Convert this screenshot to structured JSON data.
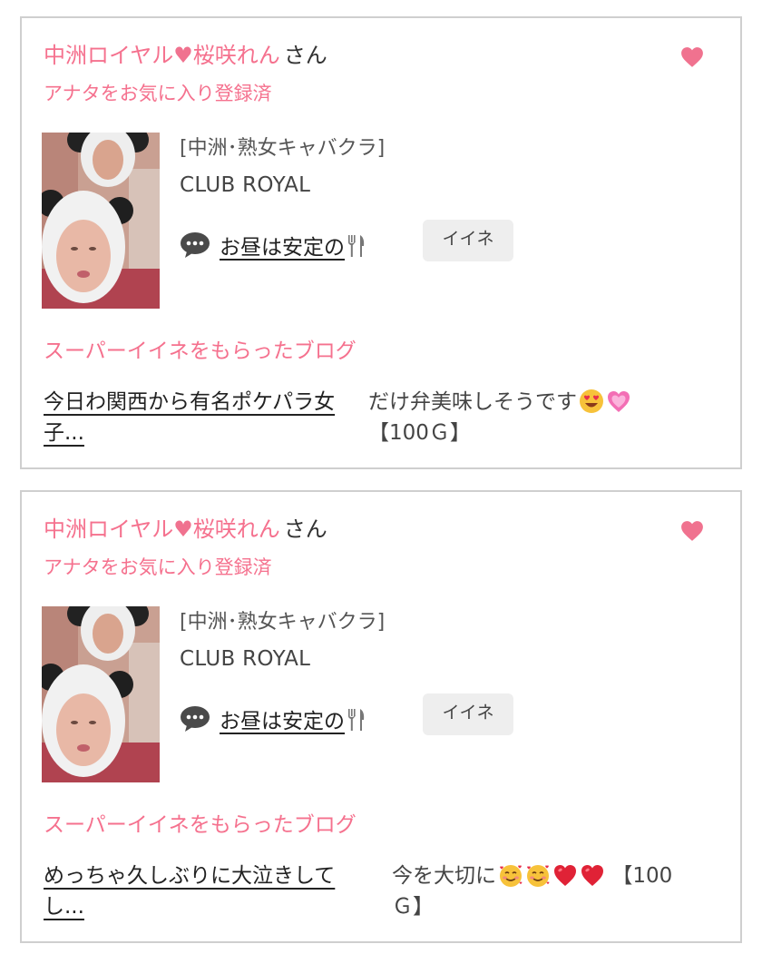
{
  "colors": {
    "accent_pink": "#f5718e",
    "heart_pink": "#f0728f",
    "like_button_bg": "#eeeeee",
    "card_border": "#cfcfcf"
  },
  "cards": [
    {
      "girl_name_prefix": "中洲ロイヤル",
      "girl_name_heart": "♥",
      "girl_name_suffix": "桜咲れん",
      "honorific": "さん",
      "fav_icon": "heart-icon",
      "fav_status": "アナタをお気に入り登録済",
      "shop_genre": "[中洲･熟女キャバクラ]",
      "shop_name": "CLUB ROYAL",
      "blog_icon": "speech-bubble-icon",
      "blog_title": "お昼は安定の",
      "blog_title_icon": "fork-knife-icon",
      "like_label": "イイネ",
      "super_like_heading": "スーパーイイネをもらったブログ",
      "super_blog_title": "今日わ関西から有名ポケパラ女子...",
      "super_comment_text": "だけ弁美味しそうです",
      "super_comment_icons": [
        "heart-eyes-emoji",
        "pink-heart-emoji"
      ],
      "super_comment_amount": "【100Ｇ】"
    },
    {
      "girl_name_prefix": "中洲ロイヤル",
      "girl_name_heart": "♥",
      "girl_name_suffix": "桜咲れん",
      "honorific": "さん",
      "fav_icon": "heart-icon",
      "fav_status": "アナタをお気に入り登録済",
      "shop_genre": "[中洲･熟女キャバクラ]",
      "shop_name": "CLUB ROYAL",
      "blog_icon": "speech-bubble-icon",
      "blog_title": "お昼は安定の",
      "blog_title_icon": "fork-knife-icon",
      "like_label": "イイネ",
      "super_like_heading": "スーパーイイネをもらったブログ",
      "super_blog_title": "めっちゃ久しぶりに大泣きしてし...",
      "super_comment_text": "今を大切に",
      "super_comment_icons": [
        "smiling-hearts-emoji",
        "smiling-hearts-emoji",
        "red-heart-emoji",
        "red-heart-emoji"
      ],
      "super_comment_amount": "【100Ｇ】"
    }
  ]
}
